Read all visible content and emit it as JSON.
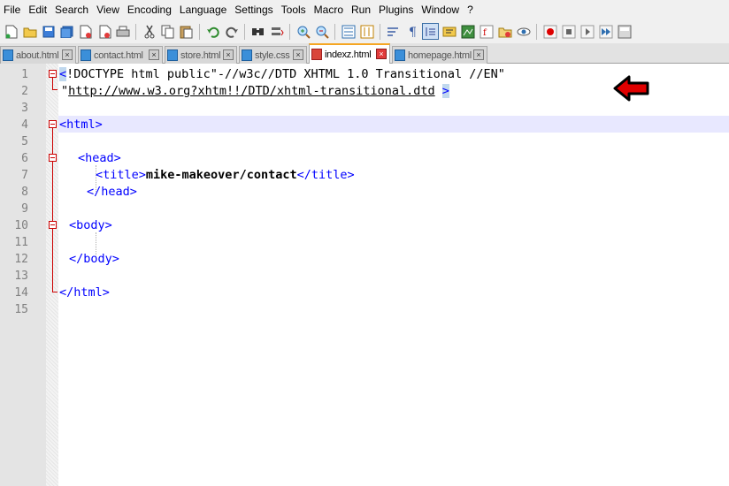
{
  "menu": [
    "File",
    "Edit",
    "Search",
    "View",
    "Encoding",
    "Language",
    "Settings",
    "Tools",
    "Macro",
    "Run",
    "Plugins",
    "Window",
    "?"
  ],
  "tabs": [
    {
      "label": "about.html",
      "active": false
    },
    {
      "label": "contact.html",
      "active": false
    },
    {
      "label": "store.html",
      "active": false
    },
    {
      "label": "style.css",
      "active": false
    },
    {
      "label": "indexz.html",
      "active": true
    },
    {
      "label": "homepage.html",
      "active": false
    }
  ],
  "editor": {
    "line_numbers": [
      "1",
      "2",
      "3",
      "4",
      "5",
      "6",
      "7",
      "8",
      "9",
      "10",
      "11",
      "12",
      "13",
      "14",
      "15"
    ],
    "line1": {
      "open_bracket": "<",
      "doctype": "!DOCTYPE html public\"-//w3c//DTD XHTML 1.0 Transitional //EN\""
    },
    "line2": {
      "quote": "\"",
      "url": "http://www.w3.org?xhtm!!/DTD/xhtml-transitional.dtd",
      "space": " ",
      "close_bracket": ">"
    },
    "line4": {
      "text": "<html>"
    },
    "line6": {
      "text": "<head>"
    },
    "line7": {
      "open": "<title>",
      "content": "mike-makeover/contact",
      "close": "</title>"
    },
    "line8": {
      "text": "</head>"
    },
    "line10": {
      "text": "<body>"
    },
    "line12": {
      "text": "</body>"
    },
    "line14": {
      "text": "</html>"
    }
  },
  "colors": {
    "tag": "#0000ff",
    "fold": "#cc0000",
    "active_tab_accent": "#f5a623",
    "arrow": "#e00000"
  }
}
